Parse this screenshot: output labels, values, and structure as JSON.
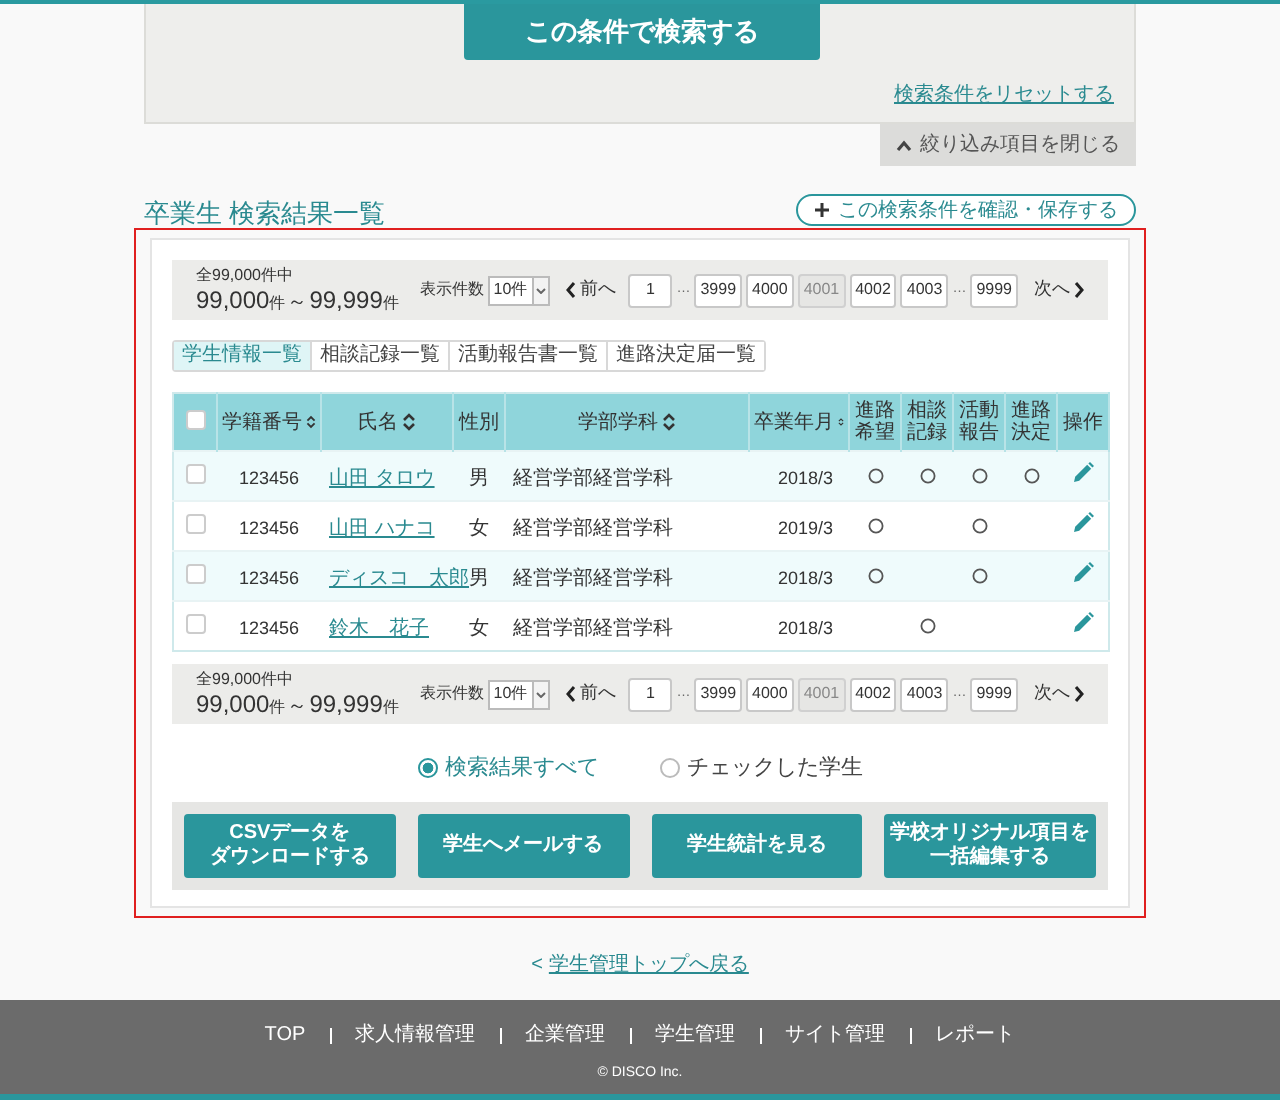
{
  "search_panel": {
    "search_button": "この条件で検索する",
    "reset_link": "検索条件をリセットする",
    "collapse_tab": "絞り込み項目を閉じる"
  },
  "results": {
    "title": "卒業生 検索結果一覧",
    "save_button": "この検索条件を確認・保存する"
  },
  "paginations": [
    {
      "total": "全99,000件中",
      "range": [
        {
          "kind": "number",
          "text": "99,000"
        },
        {
          "kind": "unit",
          "text": "件"
        },
        {
          "kind": "sep",
          "text": "～"
        },
        {
          "kind": "number",
          "text": "99,999"
        },
        {
          "kind": "unit",
          "text": "件"
        }
      ],
      "per_page_label": "表示件数",
      "per_page_value": "10件",
      "prev": "前へ",
      "next": "次へ",
      "pages": [
        {
          "kind": "page",
          "label": "1",
          "selected": false
        },
        {
          "kind": "ellipsis",
          "label": "…"
        },
        {
          "kind": "page",
          "label": "3999",
          "selected": false
        },
        {
          "kind": "page",
          "label": "4000",
          "selected": false
        },
        {
          "kind": "page",
          "label": "4001",
          "selected": true
        },
        {
          "kind": "page",
          "label": "4002",
          "selected": false
        },
        {
          "kind": "page",
          "label": "4003",
          "selected": false
        },
        {
          "kind": "ellipsis",
          "label": "…"
        },
        {
          "kind": "page",
          "label": "9999",
          "selected": false
        }
      ]
    },
    {
      "total": "全99,000件中",
      "range": [
        {
          "kind": "number",
          "text": "99,000"
        },
        {
          "kind": "unit",
          "text": "件"
        },
        {
          "kind": "sep",
          "text": "～"
        },
        {
          "kind": "number",
          "text": "99,999"
        },
        {
          "kind": "unit",
          "text": "件"
        }
      ],
      "per_page_label": "表示件数",
      "per_page_value": "10件",
      "prev": "前へ",
      "next": "次へ",
      "pages": [
        {
          "kind": "page",
          "label": "1",
          "selected": false
        },
        {
          "kind": "ellipsis",
          "label": "…"
        },
        {
          "kind": "page",
          "label": "3999",
          "selected": false
        },
        {
          "kind": "page",
          "label": "4000",
          "selected": false
        },
        {
          "kind": "page",
          "label": "4001",
          "selected": true
        },
        {
          "kind": "page",
          "label": "4002",
          "selected": false
        },
        {
          "kind": "page",
          "label": "4003",
          "selected": false
        },
        {
          "kind": "ellipsis",
          "label": "…"
        },
        {
          "kind": "page",
          "label": "9999",
          "selected": false
        }
      ]
    }
  ],
  "tabs": [
    {
      "label": "学生情報一覧",
      "selected": true
    },
    {
      "label": "相談記録一覧",
      "selected": false
    },
    {
      "label": "活動報告書一覧",
      "selected": false
    },
    {
      "label": "進路決定届一覧",
      "selected": false
    }
  ],
  "table": {
    "header_checked": false,
    "columns": [
      {
        "label": "学籍番号",
        "sortable": true
      },
      {
        "label": "氏名",
        "sortable": true
      },
      {
        "label": "性別",
        "sortable": false
      },
      {
        "label": "学部学科",
        "sortable": true
      },
      {
        "label": "卒業年月",
        "sortable": true
      },
      {
        "label": "進路希望",
        "sortable": false
      },
      {
        "label": "相談記録",
        "sortable": false
      },
      {
        "label": "活動報告",
        "sortable": false
      },
      {
        "label": "進路決定",
        "sortable": false
      },
      {
        "label": "操作",
        "sortable": false
      }
    ],
    "rows": [
      {
        "checked": false,
        "student_no": "123456",
        "name": "山田 タロウ",
        "gender": "男",
        "department": "経営学部経営学科",
        "graduation": "2018/3",
        "marks": [
          true,
          true,
          true,
          true
        ]
      },
      {
        "checked": false,
        "student_no": "123456",
        "name": "山田 ハナコ",
        "gender": "女",
        "department": "経営学部経営学科",
        "graduation": "2019/3",
        "marks": [
          true,
          false,
          true,
          false
        ]
      },
      {
        "checked": false,
        "student_no": "123456",
        "name": "ディスコ　太郎",
        "gender": "男",
        "department": "経営学部経営学科",
        "graduation": "2018/3",
        "marks": [
          true,
          false,
          true,
          false
        ]
      },
      {
        "checked": false,
        "student_no": "123456",
        "name": "鈴木　花子",
        "gender": "女",
        "department": "経営学部経営学科",
        "graduation": "2018/3",
        "marks": [
          false,
          true,
          false,
          false
        ]
      }
    ]
  },
  "scope": [
    {
      "label": "検索結果すべて",
      "selected": true
    },
    {
      "label": "チェックした学生",
      "selected": false
    }
  ],
  "actions": [
    {
      "lines": [
        "CSVデータを",
        "ダウンロードする"
      ]
    },
    {
      "lines": [
        "学生へメールする"
      ]
    },
    {
      "lines": [
        "学生統計を見る"
      ]
    },
    {
      "lines": [
        "学校オリジナル項目を",
        "一括編集する"
      ]
    }
  ],
  "back_link": {
    "prefix": "<",
    "label": "学生管理トップへ戻る"
  },
  "footer": {
    "nav": [
      "TOP",
      "求人情報管理",
      "企業管理",
      "学生管理",
      "サイト管理",
      "レポート"
    ],
    "copyright": "© DISCO Inc."
  }
}
